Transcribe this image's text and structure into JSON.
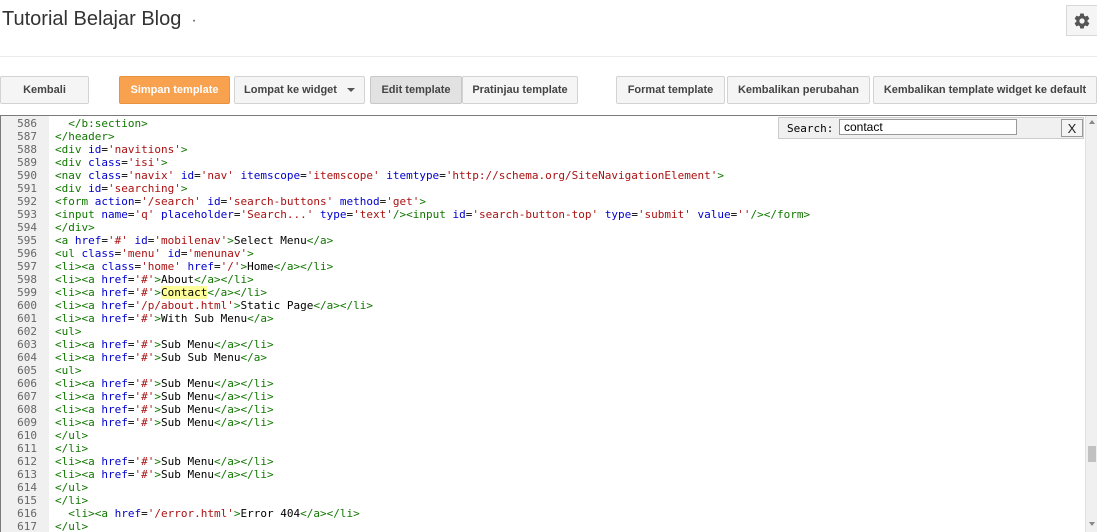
{
  "header": {
    "blog_title": "Tutorial Belajar Blog",
    "title_dot": "·",
    "settings_icon": "gear-icon"
  },
  "toolbar": {
    "back": "Kembali",
    "save": "Simpan template",
    "jump_to_widget": "Lompat ke widget",
    "edit_template": "Edit template",
    "preview_template": "Pratinjau template",
    "format_template": "Format template",
    "revert_changes": "Kembalikan perubahan",
    "revert_widget_defaults": "Kembalikan template widget ke default"
  },
  "search": {
    "label": "Search:",
    "value": "contact",
    "close": "X"
  },
  "editor": {
    "lines": [
      {
        "n": "586",
        "t": "  </b:section>"
      },
      {
        "n": "587",
        "t": "</header>"
      },
      {
        "n": "588",
        "t": "<div id='navitions'>"
      },
      {
        "n": "589",
        "t": "<div class='isi'>"
      },
      {
        "n": "590",
        "t": "<nav class='navix' id='nav' itemscope='itemscope' itemtype='http://schema.org/SiteNavigationElement'>"
      },
      {
        "n": "591",
        "t": "<div id='searching'>"
      },
      {
        "n": "592",
        "t": "<form action='/search' id='search-buttons' method='get'>"
      },
      {
        "n": "593",
        "t": "<input name='q' placeholder='Search...' type='text'/><input id='search-button-top' type='submit' value=''/></form>"
      },
      {
        "n": "594",
        "t": "</div>"
      },
      {
        "n": "595",
        "t": "<a href='#' id='mobilenav'>Select Menu</a>"
      },
      {
        "n": "596",
        "t": "<ul class='menu' id='menunav'>"
      },
      {
        "n": "597",
        "t": "<li><a class='home' href='/'>Home</a></li>"
      },
      {
        "n": "598",
        "t": "<li><a href='#'>About</a></li>"
      },
      {
        "n": "599",
        "t": "<li><a href='#'>Contact</a></li>"
      },
      {
        "n": "600",
        "t": "<li><a href='/p/about.html'>Static Page</a></li>"
      },
      {
        "n": "601",
        "t": "<li><a href='#'>With Sub Menu</a>"
      },
      {
        "n": "602",
        "t": "<ul>"
      },
      {
        "n": "603",
        "t": "<li><a href='#'>Sub Menu</a></li>"
      },
      {
        "n": "604",
        "t": "<li><a href='#'>Sub Sub Menu</a>"
      },
      {
        "n": "605",
        "t": "<ul>"
      },
      {
        "n": "606",
        "t": "<li><a href='#'>Sub Menu</a></li>"
      },
      {
        "n": "607",
        "t": "<li><a href='#'>Sub Menu</a></li>"
      },
      {
        "n": "608",
        "t": "<li><a href='#'>Sub Menu</a></li>"
      },
      {
        "n": "609",
        "t": "<li><a href='#'>Sub Menu</a></li>"
      },
      {
        "n": "610",
        "t": "</ul>"
      },
      {
        "n": "611",
        "t": "</li>"
      },
      {
        "n": "612",
        "t": "<li><a href='#'>Sub Menu</a></li>"
      },
      {
        "n": "613",
        "t": "<li><a href='#'>Sub Menu</a></li>"
      },
      {
        "n": "614",
        "t": "</ul>"
      },
      {
        "n": "615",
        "t": "</li>"
      },
      {
        "n": "616",
        "t": "  <li><a href='/error.html'>Error 404</a></li>"
      },
      {
        "n": "617",
        "t": "</ul>"
      }
    ],
    "highlight_term": "Contact",
    "colors": {
      "tag": "#117700",
      "attribute": "#0000cc",
      "string": "#aa1111",
      "match_highlight": "#ffff99",
      "save_button": "#f8a14f"
    }
  }
}
